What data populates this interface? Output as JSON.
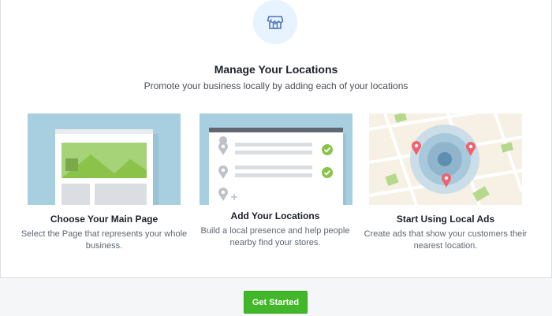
{
  "header": {
    "icon": "storefront-icon",
    "title": "Manage Your Locations",
    "subtitle": "Promote your business locally by adding each of your locations"
  },
  "cards": [
    {
      "illustration": "page-layout-illustration",
      "title": "Choose Your Main Page",
      "description": "Select the Page that represents your whole business."
    },
    {
      "illustration": "location-list-illustration",
      "title": "Add Your Locations",
      "description": "Build a local presence and help people nearby find your stores."
    },
    {
      "illustration": "map-pins-illustration",
      "title": "Start Using Local Ads",
      "description": "Create ads that show your customers their nearest location."
    }
  ],
  "footer": {
    "button_label": "Get Started"
  },
  "colors": {
    "primary_button": "#42b72a",
    "card_blue": "#a8cfe0",
    "check_green": "#8bc34a",
    "pin_red": "#f0616e",
    "icon_circle": "#e7f3ff"
  }
}
